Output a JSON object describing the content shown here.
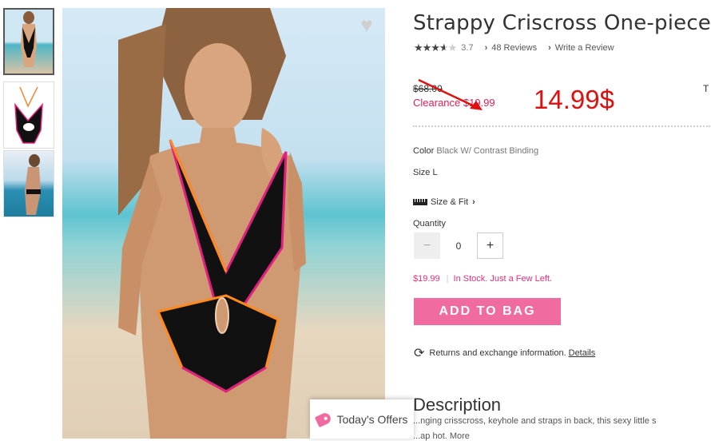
{
  "product": {
    "title": "Strappy Criscross One-piece",
    "rating_value": "3.7",
    "rating_stars": 3.7,
    "reviews_link": "48 Reviews",
    "write_review_link": "Write a Review",
    "original_price": "$68.00",
    "clearance_price": "Clearance $19.99",
    "annotation_price": "14.99$",
    "edge_char": "T",
    "color_label": "Color",
    "color_value": "Black W/ Contrast Binding",
    "size_label": "Size",
    "size_value": "L",
    "size_fit_link": "Size & Fit",
    "quantity_label": "Quantity",
    "quantity_value": "0",
    "minus": "−",
    "plus": "+",
    "price_line": "$19.99",
    "stock_status": "In Stock. Just a Few Left.",
    "add_to_bag": "ADD TO BAG",
    "returns_text": "Returns and exchange information.",
    "returns_link": "Details",
    "description_heading": "Description",
    "description_text": "...nging crisscross, keyhole and straps in back, this sexy little s",
    "description_text2": "...ap hot.  More"
  },
  "offers": {
    "label": "Today's Offers"
  },
  "colors": {
    "accent_pink": "#f06ba0",
    "clearance_red": "#e01f5a",
    "annotation_red": "#e01010"
  },
  "icons": [
    "heart-icon",
    "star-icon",
    "chevron-right-icon",
    "ruler-icon",
    "refresh-icon",
    "tag-icon"
  ]
}
